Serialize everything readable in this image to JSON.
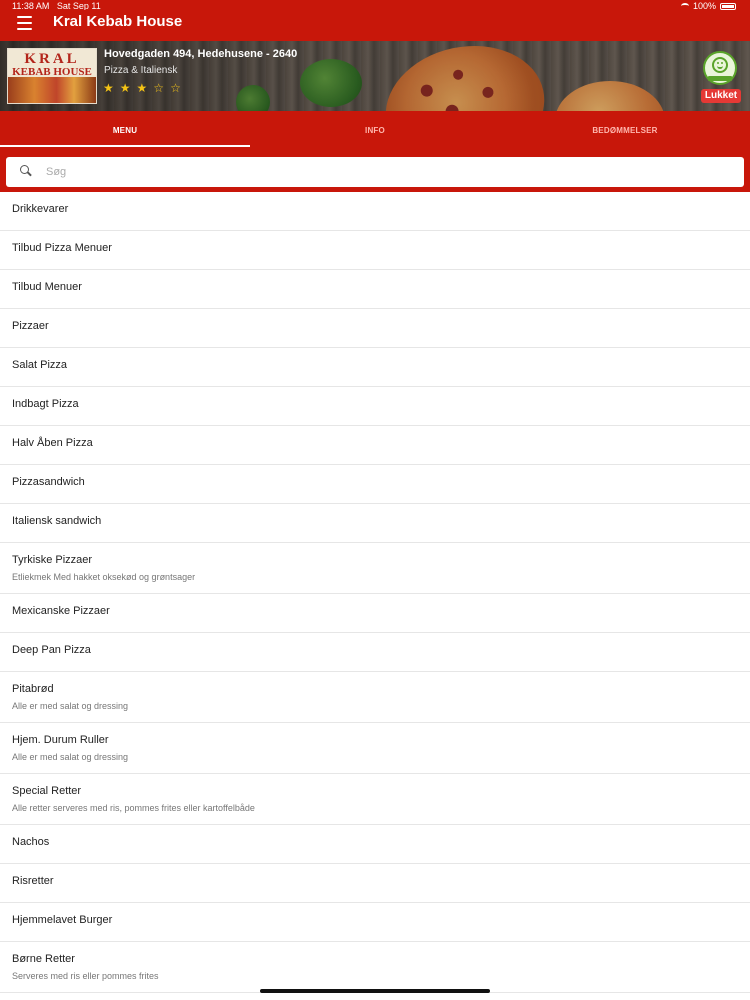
{
  "status_bar": {
    "time": "11:38 AM",
    "date": "Sat Sep 11",
    "battery": "100%"
  },
  "app_bar": {
    "title": "Kral Kebab House"
  },
  "restaurant": {
    "logo_line1": "KRAL",
    "logo_line2": "KEBAB HOUSE",
    "address": "Hovedgaden 494, Hedehusene - 2640",
    "category": "Pizza & Italiensk",
    "rating": 3,
    "rating_max": 5,
    "status": "Lukket"
  },
  "colors": {
    "brand": "#c8170a",
    "status_closed": "#e53935",
    "star": "#f4c315"
  },
  "tabs": [
    {
      "label": "MENU",
      "active": true
    },
    {
      "label": "INFO",
      "active": false
    },
    {
      "label": "BEDØMMELSER",
      "active": false
    }
  ],
  "search": {
    "placeholder": "Søg",
    "value": ""
  },
  "menu": [
    {
      "title": "Drikkevarer",
      "subtitle": ""
    },
    {
      "title": "Tilbud Pizza Menuer",
      "subtitle": ""
    },
    {
      "title": "Tilbud Menuer",
      "subtitle": ""
    },
    {
      "title": "Pizzaer",
      "subtitle": ""
    },
    {
      "title": "Salat Pizza",
      "subtitle": ""
    },
    {
      "title": "Indbagt Pizza",
      "subtitle": ""
    },
    {
      "title": "Halv Åben Pizza",
      "subtitle": ""
    },
    {
      "title": "Pizzasandwich",
      "subtitle": ""
    },
    {
      "title": "Italiensk sandwich",
      "subtitle": ""
    },
    {
      "title": "Tyrkiske Pizzaer",
      "subtitle": "Etliekmek Med hakket oksekød og grøntsager"
    },
    {
      "title": "Mexicanske Pizzaer",
      "subtitle": ""
    },
    {
      "title": "Deep Pan Pizza",
      "subtitle": ""
    },
    {
      "title": "Pitabrød",
      "subtitle": "Alle er med salat og dressing"
    },
    {
      "title": "Hjem. Durum Ruller",
      "subtitle": "Alle er med salat og dressing"
    },
    {
      "title": "Special Retter",
      "subtitle": "Alle retter serveres med ris, pommes frites eller kartoffelbåde"
    },
    {
      "title": "Nachos",
      "subtitle": ""
    },
    {
      "title": "Risretter",
      "subtitle": ""
    },
    {
      "title": "Hjemmelavet Burger",
      "subtitle": ""
    },
    {
      "title": "Børne Retter",
      "subtitle": "Serveres med ris eller pommes frites"
    }
  ]
}
